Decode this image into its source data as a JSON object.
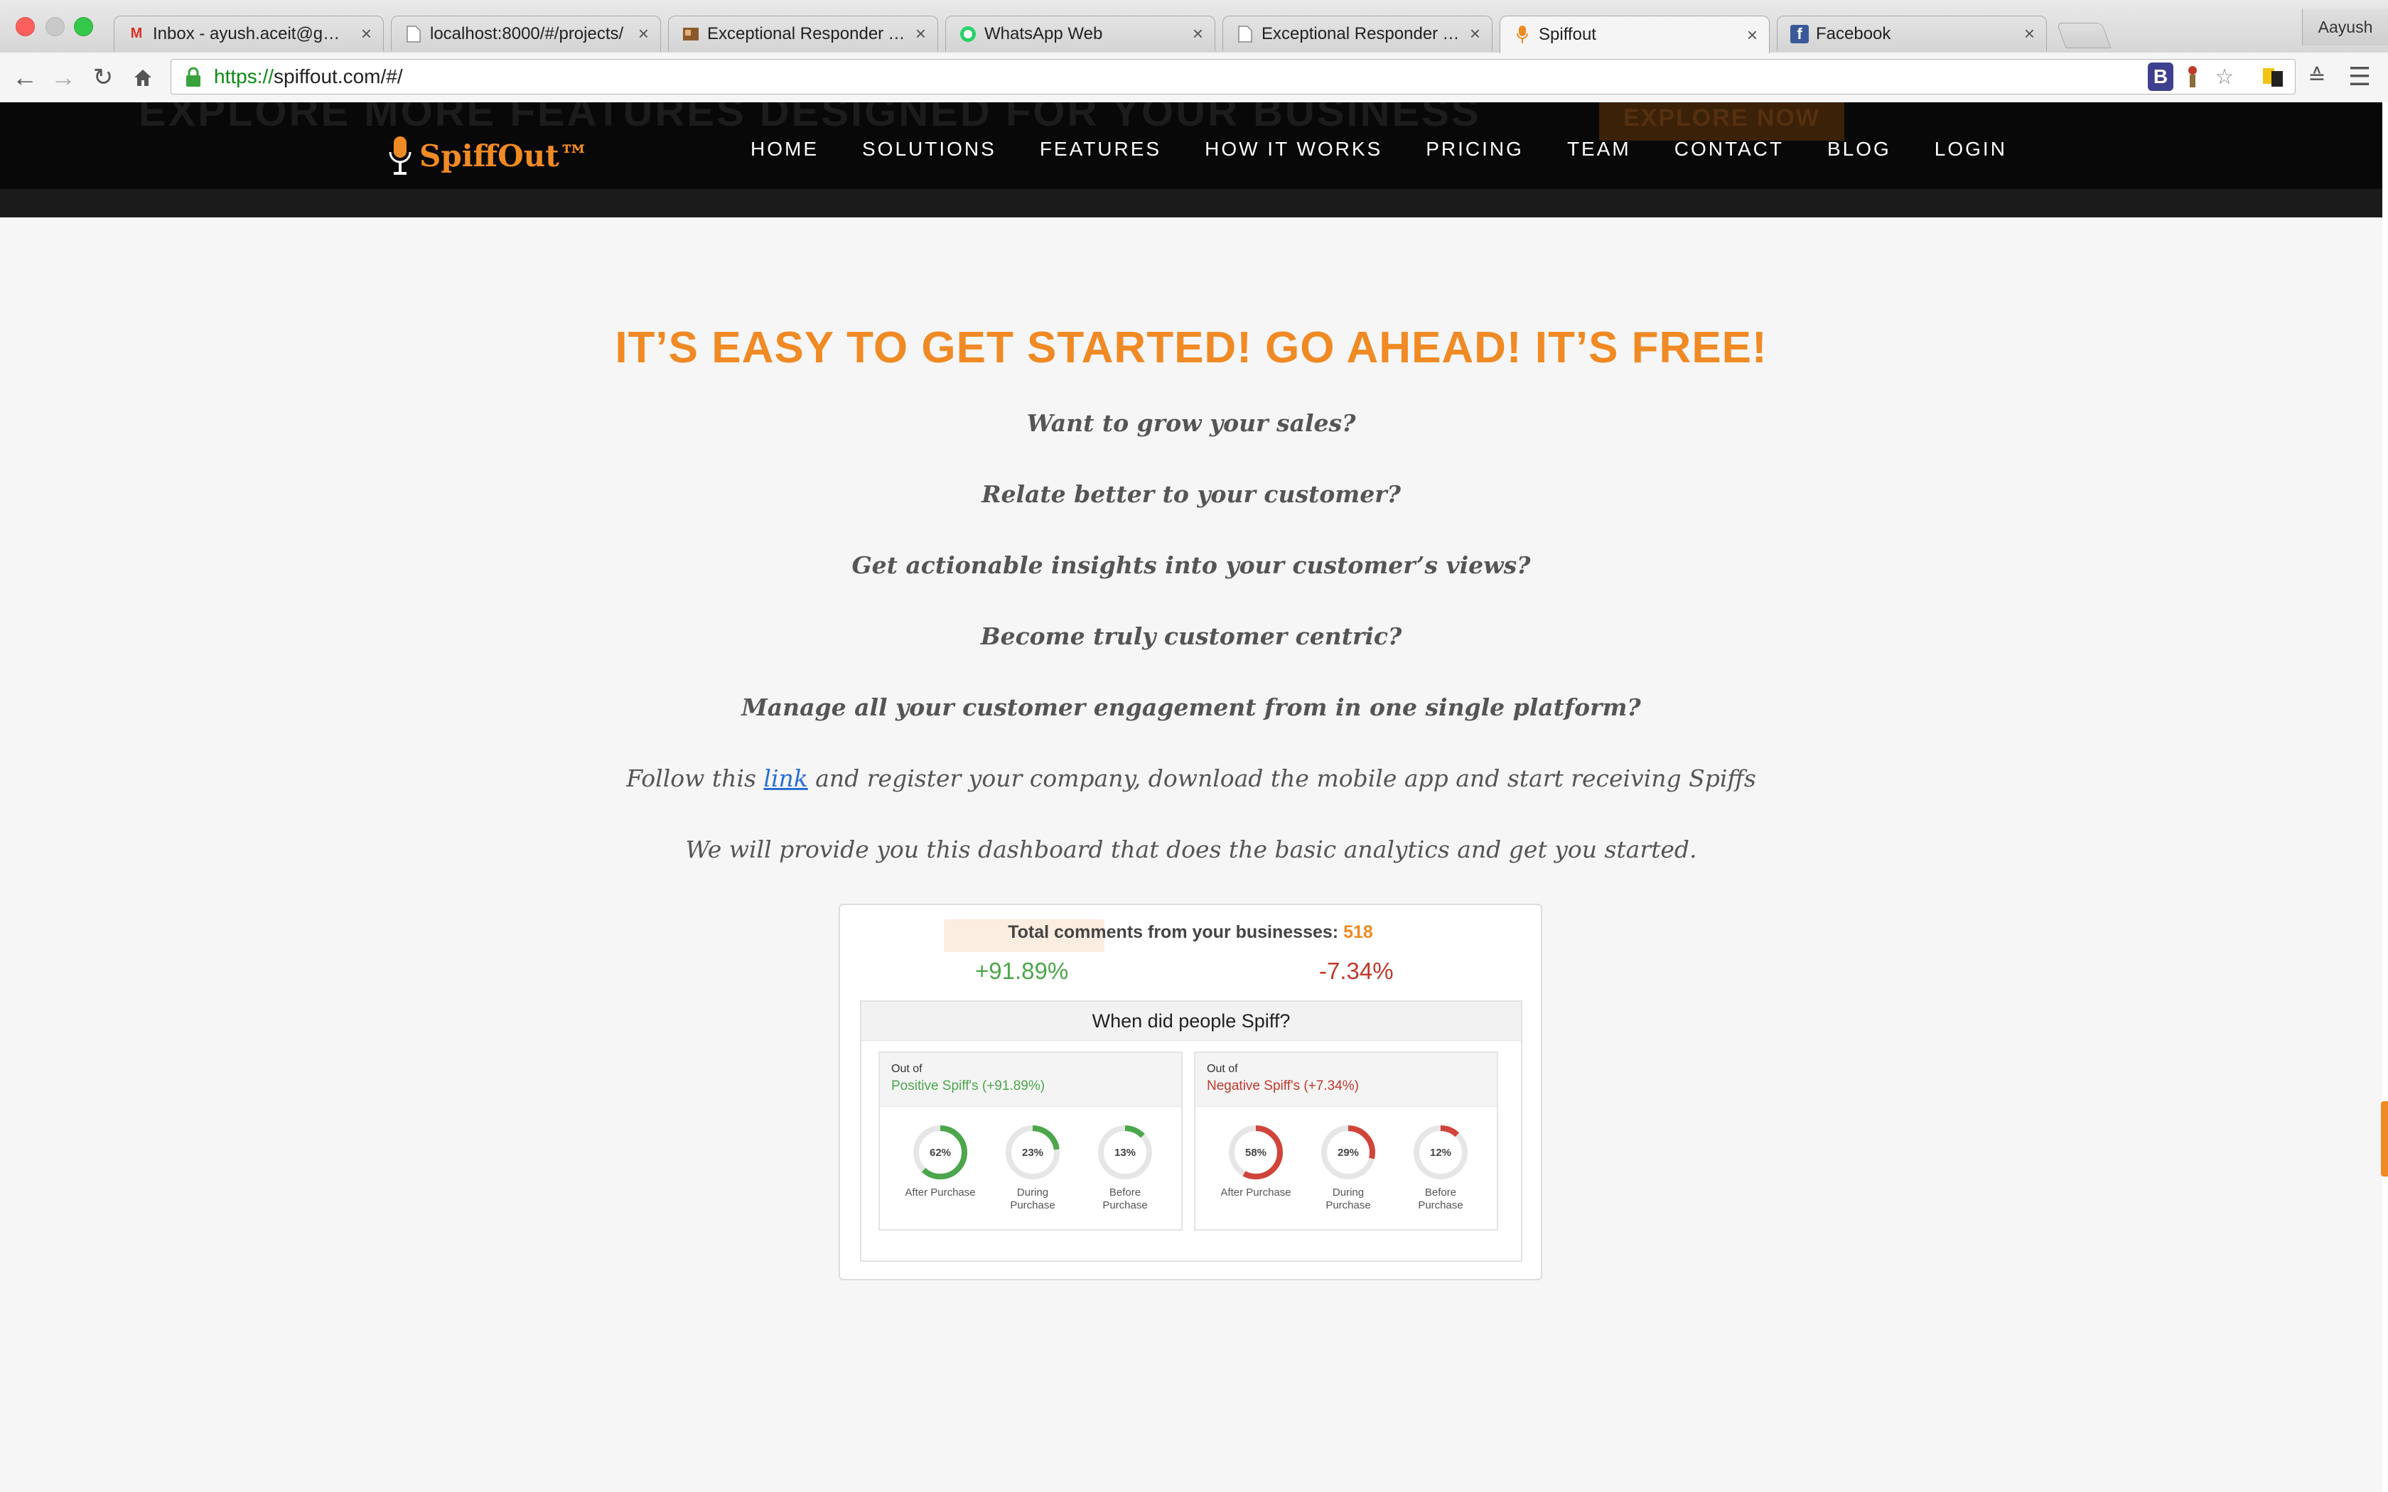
{
  "browser": {
    "tabs": [
      {
        "title": "Inbox - ayush.aceit@gmail.com",
        "icon": "gmail-icon",
        "active": false
      },
      {
        "title": "localhost:8000/#/projects/",
        "icon": "page-icon",
        "active": false
      },
      {
        "title": "Exceptional Responder Tool",
        "icon": "responder-icon",
        "active": false
      },
      {
        "title": "WhatsApp Web",
        "icon": "whatsapp-icon",
        "active": false
      },
      {
        "title": "Exceptional Responder Tool",
        "icon": "page-icon",
        "active": false
      },
      {
        "title": "Spiffout",
        "icon": "spiffout-icon",
        "active": true
      },
      {
        "title": "Facebook",
        "icon": "facebook-icon",
        "active": false
      }
    ],
    "profile": "Aayush",
    "url_scheme": "https://",
    "url_rest": "spiffout.com/#/"
  },
  "site": {
    "behind_text": "EXPLORE MORE FEATURES DESIGNED FOR YOUR BUSINESS",
    "behind_button": "EXPLORE NOW",
    "logo": "SpiffOut™",
    "nav": [
      "HOME",
      "SOLUTIONS",
      "FEATURES",
      "HOW IT WORKS",
      "PRICING",
      "TEAM",
      "CONTACT",
      "BLOG",
      "LOGIN"
    ],
    "accent": "#f08a24"
  },
  "content": {
    "headline": "IT’S EASY TO GET STARTED! GO AHEAD! IT’S FREE!",
    "questions": [
      "Want to grow your sales?",
      "Relate better to your customer?",
      "Get actionable insights into your customer’s views?",
      "Become truly customer centric?",
      "Manage all your customer engagement from in one single platform?"
    ],
    "follow_before": "Follow this ",
    "follow_link": "link",
    "follow_after": " and register your company, download the mobile app and start receiving Spiffs",
    "dashboard_note": "We will provide you this dashboard that does the basic analytics and get you started."
  },
  "dashboard": {
    "total_label": "Total comments from your businesses: ",
    "total_value": "518",
    "positive_pct": "+91.89%",
    "negative_pct": "-7.34%",
    "panel_title": "When did people Spiff?",
    "positive": {
      "outof": "Out of",
      "label": "Positive Spiff's (+91.89%)",
      "color": "#4ca64c",
      "donuts": [
        {
          "pct": 62,
          "text": "62%",
          "caption": "After Purchase"
        },
        {
          "pct": 23,
          "text": "23%",
          "caption": "During Purchase"
        },
        {
          "pct": 13,
          "text": "13%",
          "caption": "Before Purchase"
        }
      ]
    },
    "negative": {
      "outof": "Out of",
      "label": "Negative Spiff's (+7.34%)",
      "color": "#d0443a",
      "donuts": [
        {
          "pct": 58,
          "text": "58%",
          "caption": "After Purchase"
        },
        {
          "pct": 29,
          "text": "29%",
          "caption": "During Purchase"
        },
        {
          "pct": 12,
          "text": "12%",
          "caption": "Before Purchase"
        }
      ]
    }
  }
}
